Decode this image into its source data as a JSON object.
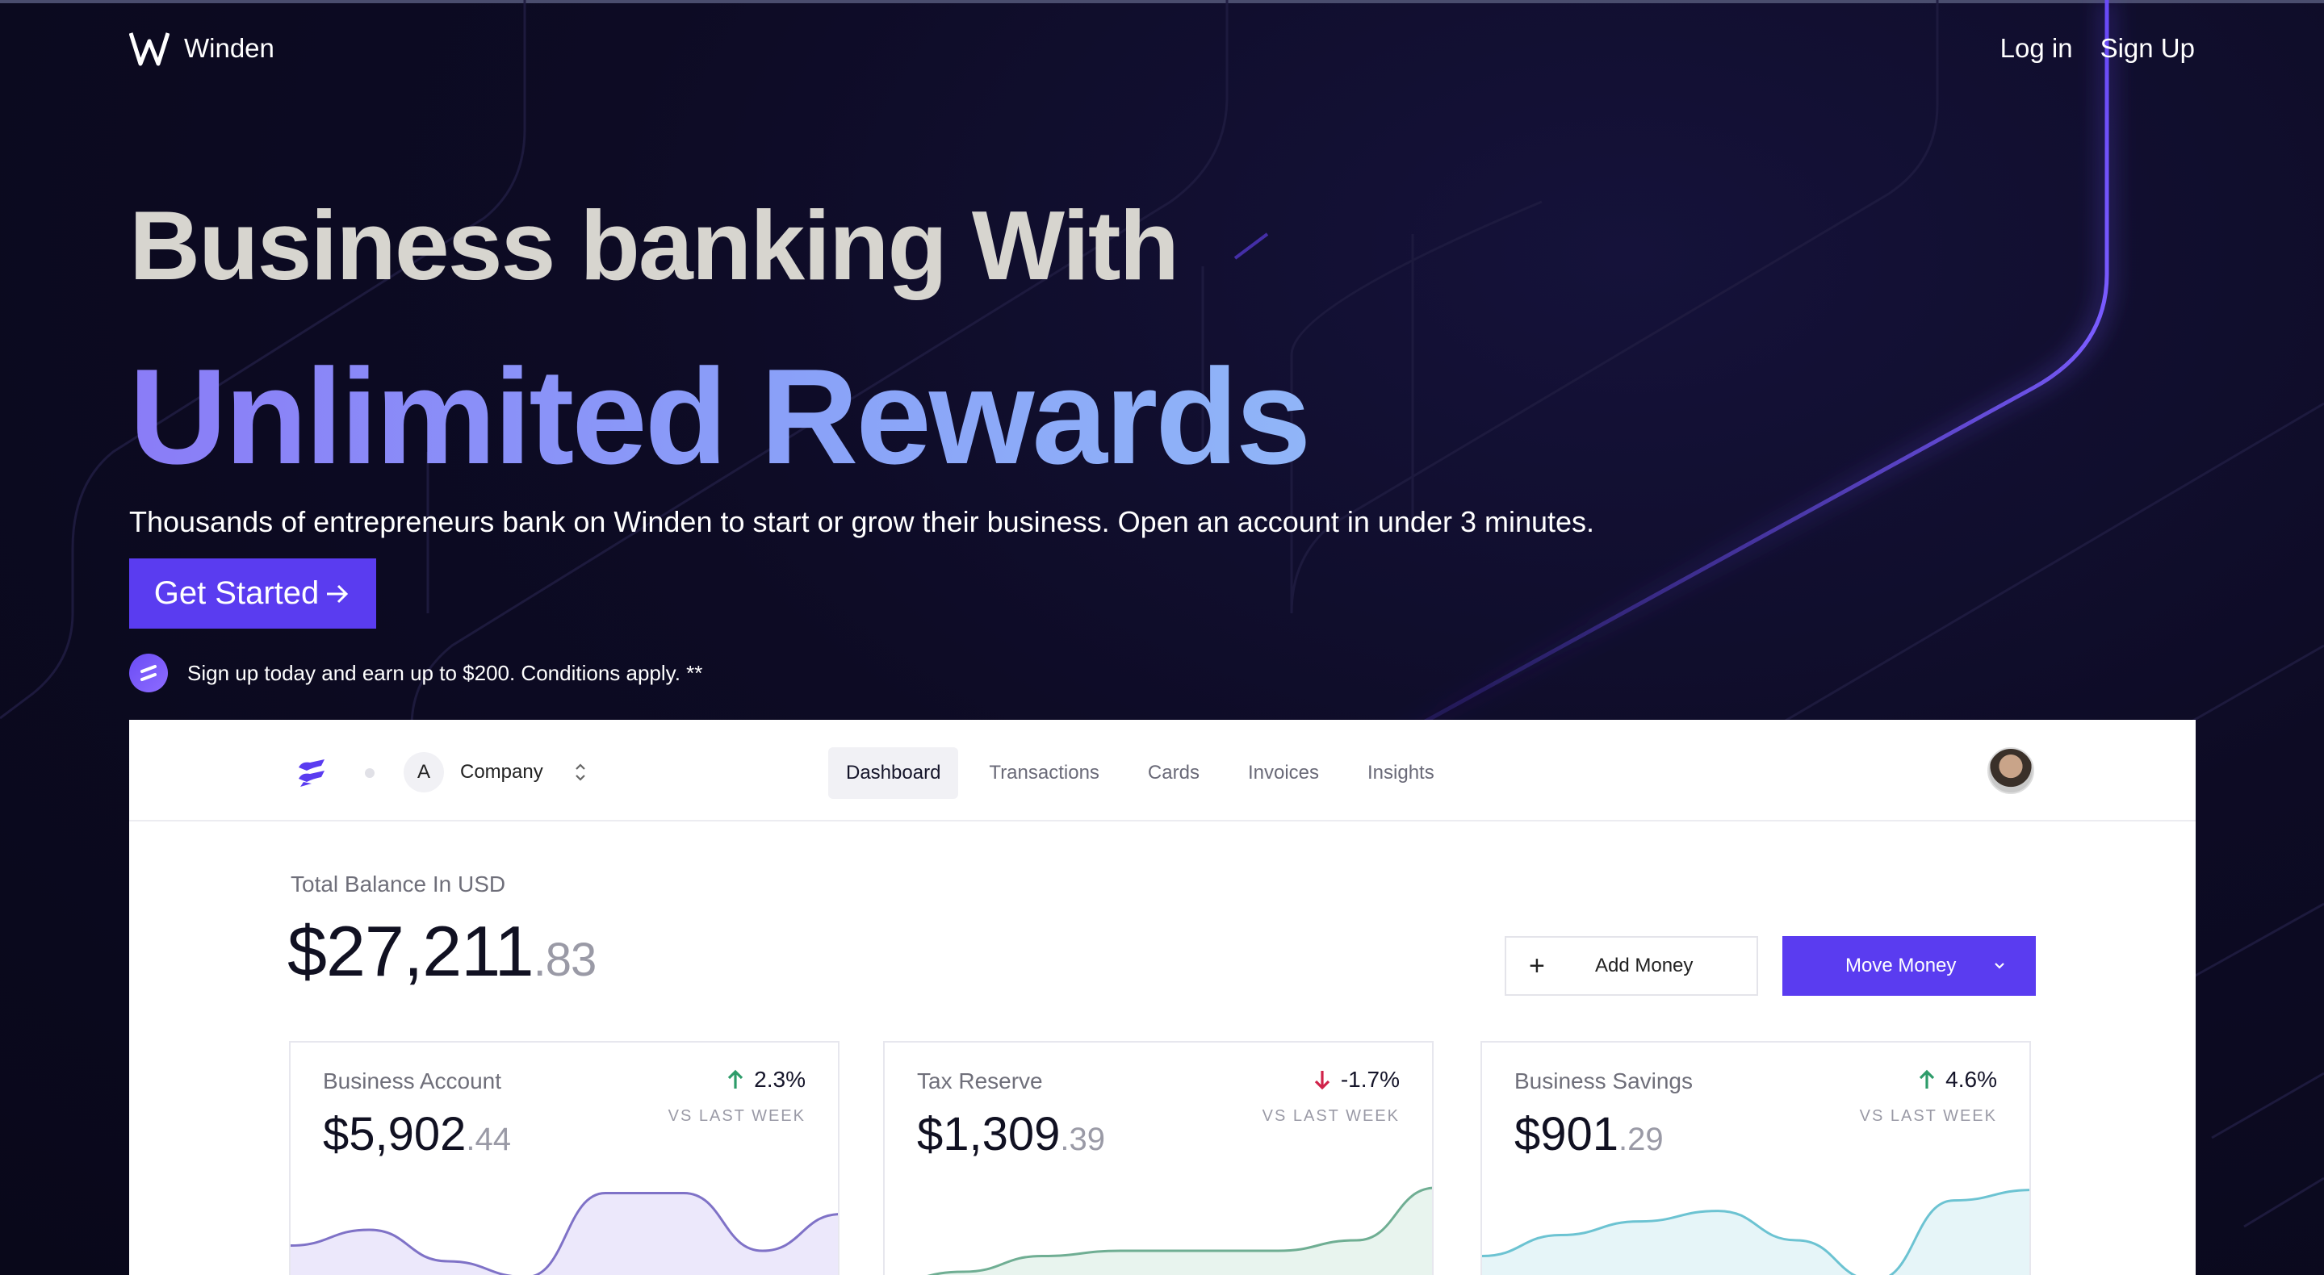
{
  "nav": {
    "brand": "Winden",
    "login": "Log in",
    "signup": "Sign Up"
  },
  "hero": {
    "title_line1": "Business banking With",
    "title_line2": "Unlimited Rewards",
    "subtitle": "Thousands of entrepreneurs bank on Winden to start or grow their business. Open an account in under 3 minutes.",
    "cta": "Get Started",
    "cta_icon": "arrow-right-icon",
    "promo": "Sign up today and earn up to $200. Conditions apply. **"
  },
  "app": {
    "company_initial": "A",
    "company_name": "Company",
    "tabs": [
      "Dashboard",
      "Transactions",
      "Cards",
      "Invoices",
      "Insights"
    ],
    "active_tab": "Dashboard",
    "balance_label": "Total Balance In USD",
    "balance_whole": "$27,211",
    "balance_cents": ".83",
    "add_money": "Add Money",
    "move_money": "Move Money",
    "accent": "#5a3cf0"
  },
  "accounts": [
    {
      "title": "Business Account",
      "amount_whole": "$5,902",
      "amount_cents": ".44",
      "delta": "2.3%",
      "direction": "up",
      "vs": "VS LAST WEEK",
      "line_color": "#7f72c7",
      "fill_color": "#ece8fb",
      "trend": [
        0.45,
        0.6,
        0.3,
        0.15,
        0.95,
        0.95,
        0.4,
        0.75
      ]
    },
    {
      "title": "Tax Reserve",
      "amount_whole": "$1,309",
      "amount_cents": ".39",
      "delta": "-1.7%",
      "direction": "down",
      "vs": "VS LAST WEEK",
      "line_color": "#6fae93",
      "fill_color": "#e8f4ee",
      "trend": [
        0.1,
        0.2,
        0.35,
        0.4,
        0.4,
        0.4,
        0.5,
        1.0
      ]
    },
    {
      "title": "Business Savings",
      "amount_whole": "$901",
      "amount_cents": ".29",
      "delta": "4.6%",
      "direction": "up",
      "vs": "VS LAST WEEK",
      "line_color": "#6cc3d2",
      "fill_color": "#e6f5f8",
      "trend": [
        0.35,
        0.55,
        0.68,
        0.78,
        0.5,
        0.12,
        0.88,
        0.98
      ]
    }
  ],
  "colors": {
    "up_arrow": "#2e9c6a",
    "down_arrow": "#d0234a"
  }
}
